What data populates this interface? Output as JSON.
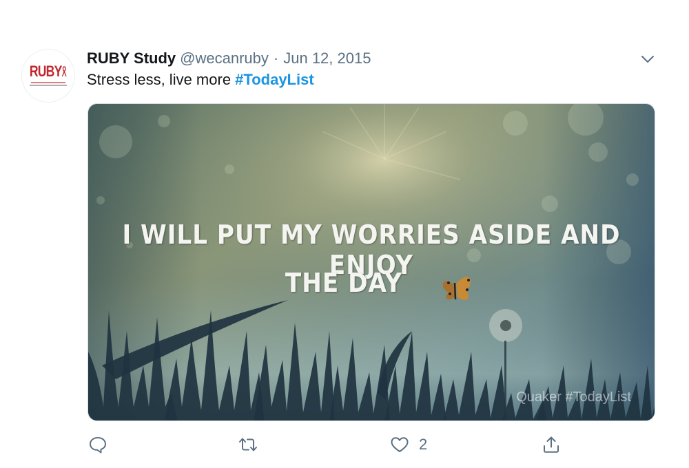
{
  "author": {
    "display_name": "RUBY Study",
    "handle": "@wecanruby",
    "separator": "·",
    "date": "Jun 12, 2015",
    "avatar_text": "RUBY"
  },
  "tweet": {
    "text": "Stress less, live more ",
    "hashtag": "#TodayList"
  },
  "media": {
    "quote_line1": "I WILL PUT MY WORRIES ASIDE AND ENJOY",
    "quote_line2": "THE DAY",
    "watermark": "Quaker #TodayList"
  },
  "actions": {
    "reply_icon": "speech-bubble-icon",
    "retweet_icon": "retweet-icon",
    "like_icon": "heart-icon",
    "like_count": "2",
    "share_icon": "share-icon"
  },
  "colors": {
    "link": "#1b95e0",
    "secondary_text": "#5b7083",
    "primary_text": "#14171a",
    "brand_red": "#c1272d"
  }
}
